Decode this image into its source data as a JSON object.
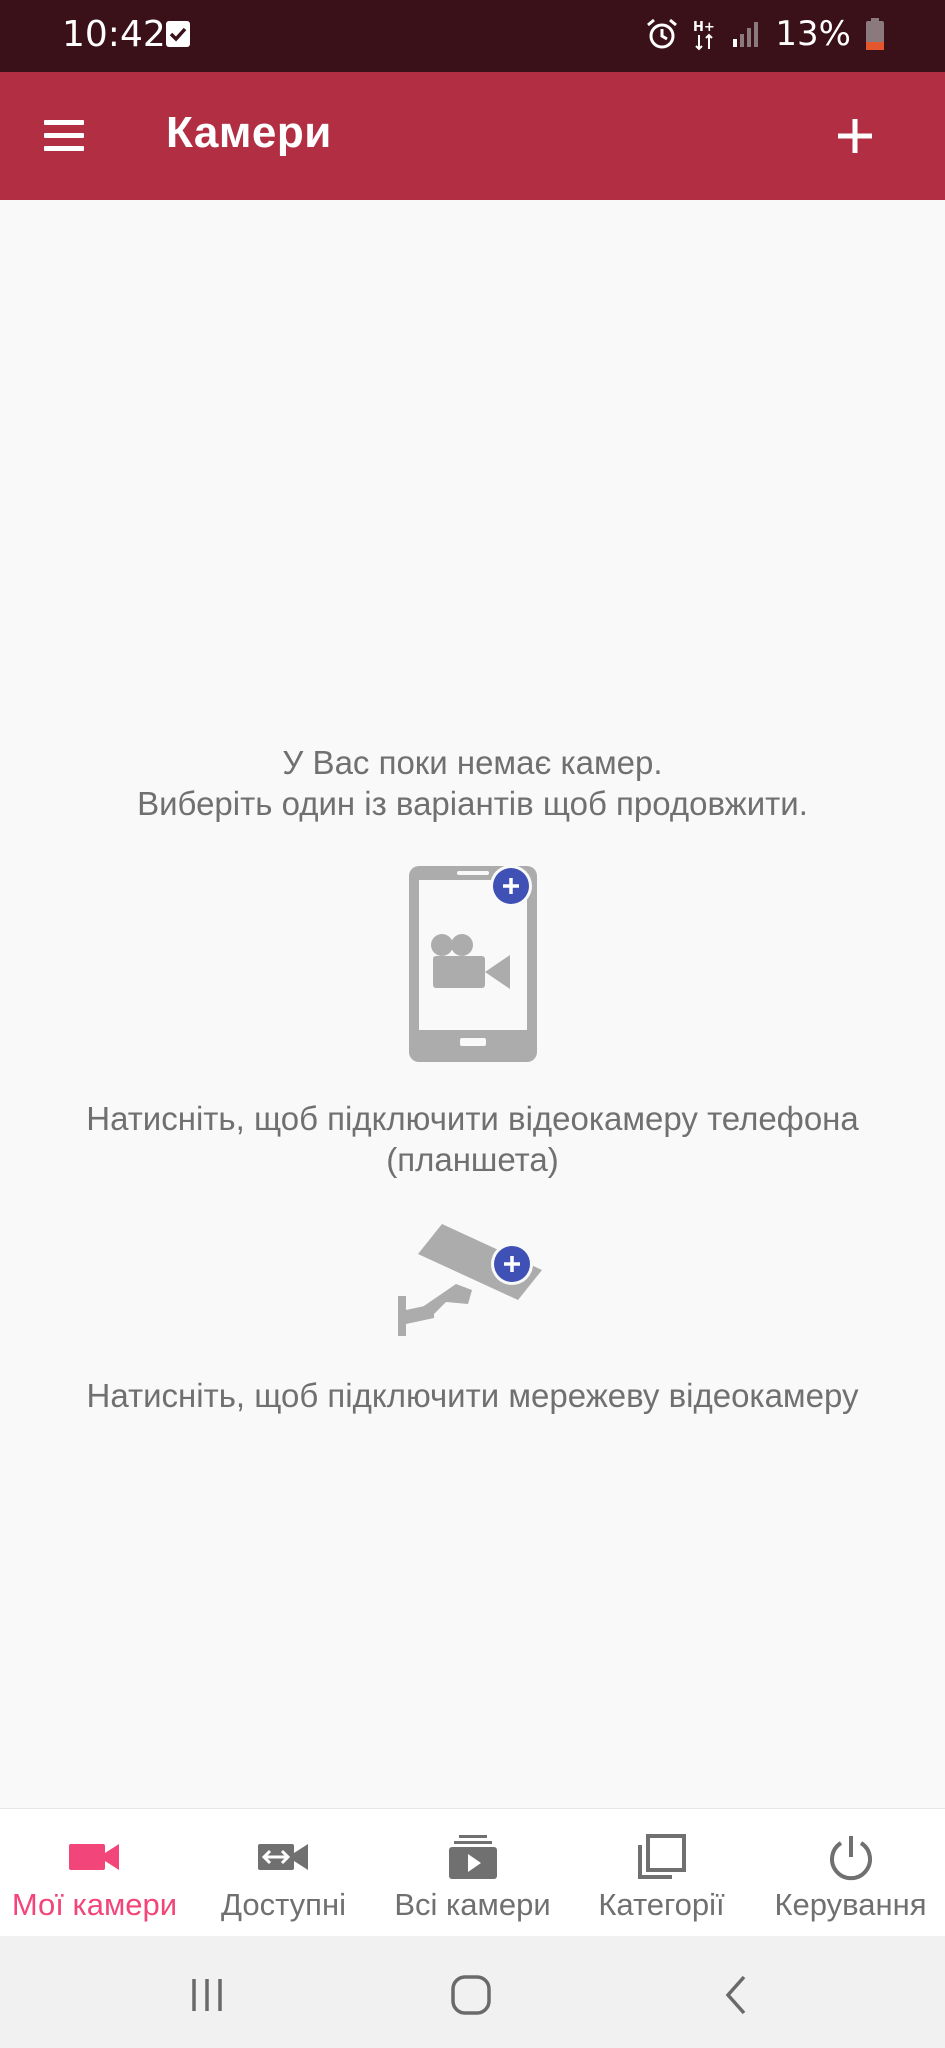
{
  "status_bar": {
    "time": "10:42",
    "battery": "13%",
    "icons": [
      "checkbox-icon",
      "alarm-icon",
      "hplus-data-icon",
      "signal-icon",
      "battery-icon"
    ]
  },
  "app_bar": {
    "title": "Камери",
    "menu_icon": "hamburger-menu-icon",
    "add_icon": "plus-icon",
    "color": "#b22f43"
  },
  "empty_state": {
    "line1": "У Вас поки немає камер.",
    "line2": "Виберіть один із варіантів щоб продовжити.",
    "phone_option_line1": "Натисніть, щоб підключити відеокамеру телефона",
    "phone_option_line2": "(планшета)",
    "network_option": "Натисніть, щоб підключити мережеву відеокамеру",
    "badge_color": "#3f51b5",
    "icon_color": "#acacac"
  },
  "bottom_nav": {
    "active_color": "#f2457a",
    "items": [
      {
        "label": "Мої камери",
        "icon": "videocam-icon",
        "active": true
      },
      {
        "label": "Доступні",
        "icon": "shared-camera-icon",
        "active": false
      },
      {
        "label": "Всі камери",
        "icon": "video-library-icon",
        "active": false
      },
      {
        "label": "Категорії",
        "icon": "categories-icon",
        "active": false
      },
      {
        "label": "Керування",
        "icon": "power-icon",
        "active": false
      }
    ]
  },
  "system_nav": {
    "icons": [
      "recents-icon",
      "home-icon",
      "back-icon"
    ]
  }
}
